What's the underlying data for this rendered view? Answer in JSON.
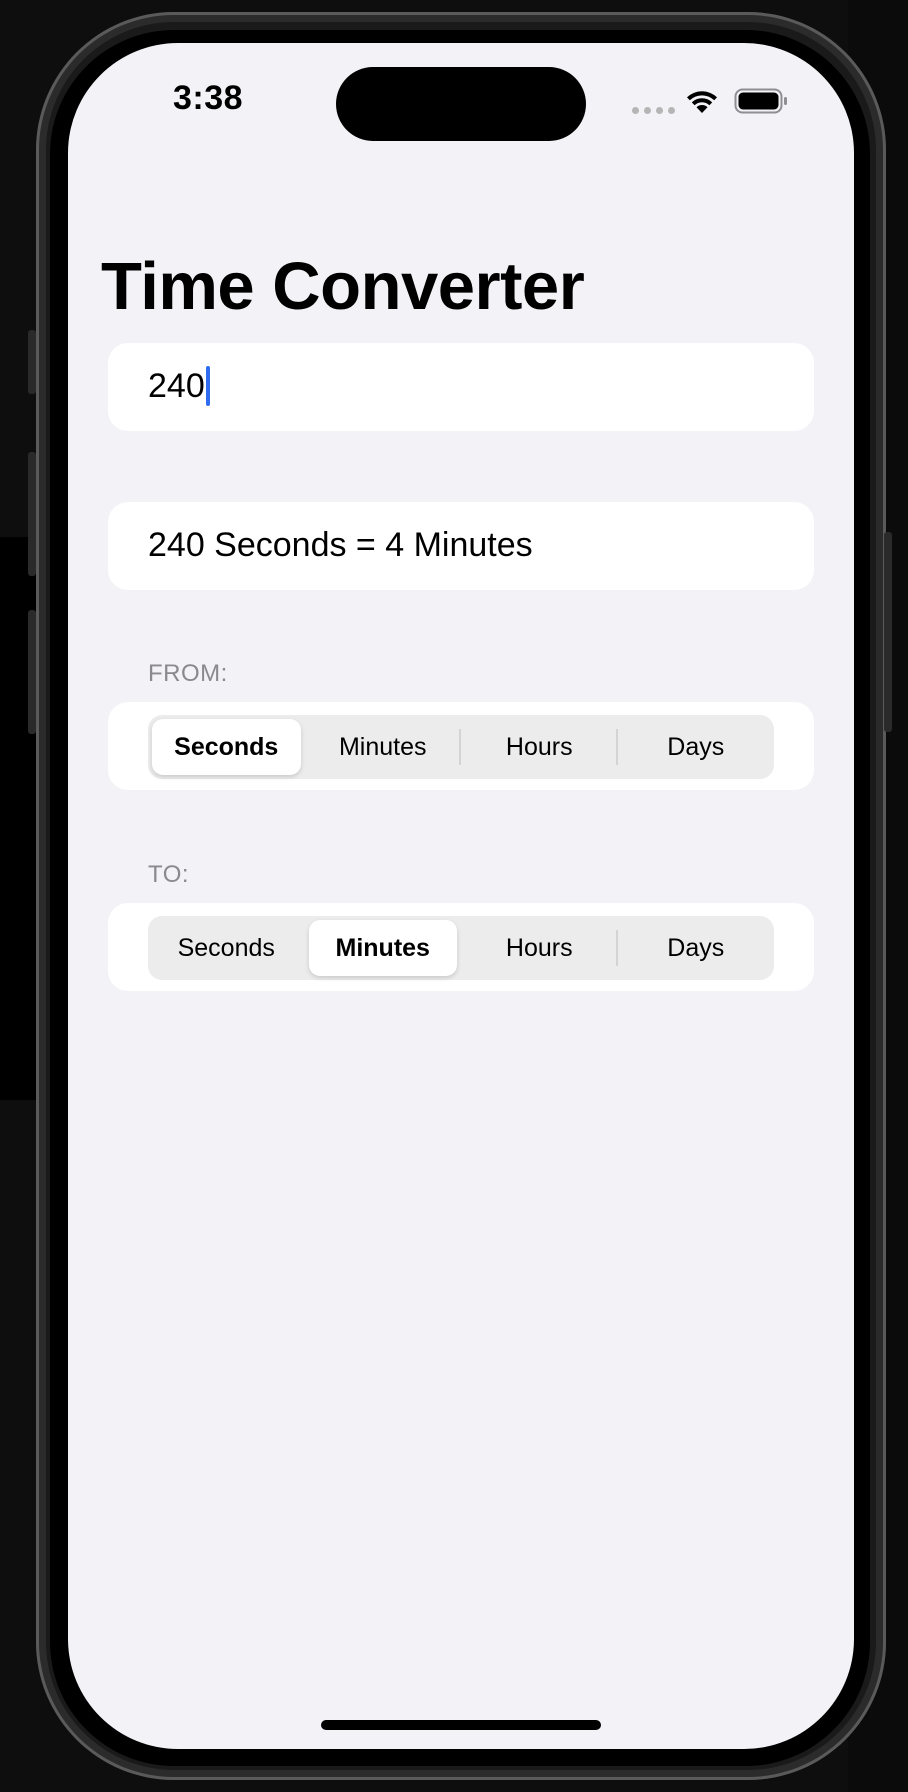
{
  "status_bar": {
    "time": "3:38"
  },
  "app": {
    "title": "Time Converter"
  },
  "input": {
    "value": "240"
  },
  "result": {
    "text": "240 Seconds = 4 Minutes"
  },
  "from": {
    "label": "FROM:",
    "options": [
      "Seconds",
      "Minutes",
      "Hours",
      "Days"
    ],
    "selected": "Seconds"
  },
  "to": {
    "label": "TO:",
    "options": [
      "Seconds",
      "Minutes",
      "Hours",
      "Days"
    ],
    "selected": "Minutes"
  },
  "colors": {
    "accent_caret": "#2f6cf0",
    "screen_background": "#f2f2f7",
    "label_gray": "#8a8a8e"
  },
  "icons": [
    "wifi-icon",
    "battery-icon",
    "signal-dots-icon"
  ]
}
